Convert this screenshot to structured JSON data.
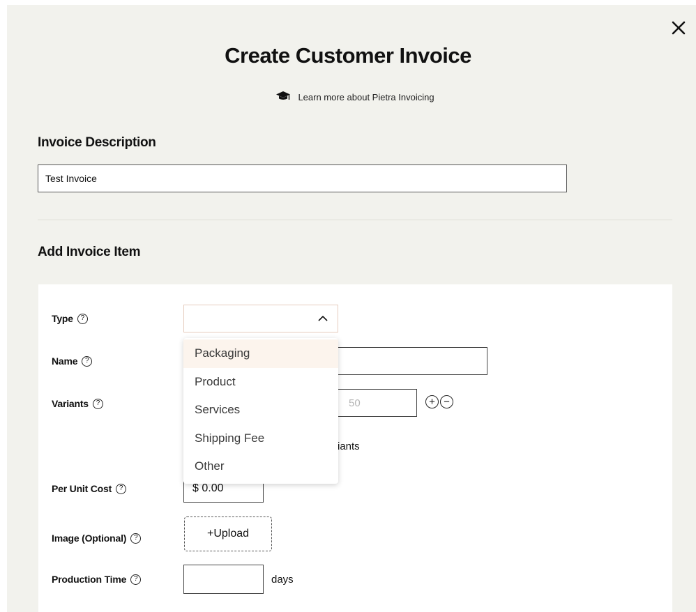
{
  "modal": {
    "title": "Create Customer Invoice",
    "learn_more": "Learn more about Pietra Invoicing"
  },
  "description": {
    "heading": "Invoice Description",
    "value": "Test Invoice"
  },
  "item": {
    "heading": "Add Invoice Item",
    "type_label": "Type",
    "name_label": "Name",
    "variants_label": "Variants",
    "variants_placeholder": "50",
    "variants_note_fragment": "riants",
    "per_unit_cost_label": "Per Unit Cost",
    "per_unit_cost_value": "$ 0.00",
    "image_label": "Image (Optional)",
    "upload_label": "+Upload",
    "production_time_label": "Production Time",
    "production_time_unit": "days"
  },
  "type_dropdown": {
    "options": [
      "Packaging",
      "Product",
      "Services",
      "Shipping Fee",
      "Other"
    ],
    "highlighted": "Packaging"
  },
  "icons": {
    "close": "close-icon",
    "learn": "graduation-cap-icon",
    "help": "question-circle-icon",
    "chevron": "chevron-up-icon",
    "add": "plus-circle-icon",
    "remove": "minus-circle-icon"
  },
  "colors": {
    "modal_bg": "#f2f2ed",
    "card_bg": "#ffffff",
    "dropdown_highlight": "#fcf4ed",
    "select_border": "#e6cbbd"
  }
}
